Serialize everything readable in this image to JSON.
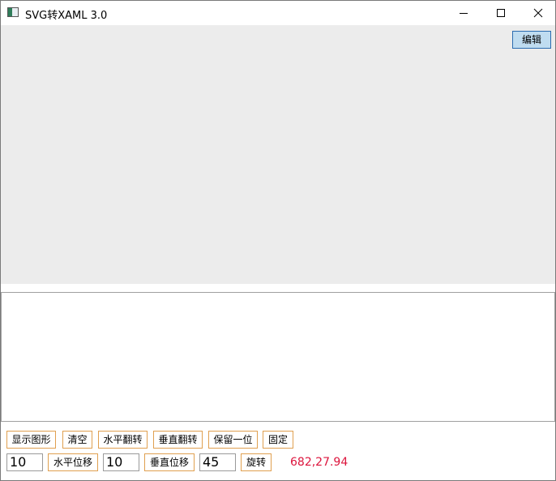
{
  "window": {
    "title": "SVG转XAML 3.0"
  },
  "canvas": {
    "edit_label": "编辑"
  },
  "toolbar": {
    "row1": {
      "show_shape": "显示图形",
      "clear": "清空",
      "flip_horizontal": "水平翻转",
      "flip_vertical": "垂直翻转",
      "keep_one_decimal": "保留一位",
      "fix": "固定"
    },
    "row2": {
      "h_offset_value": "10",
      "h_offset_label": "水平位移",
      "v_offset_value": "10",
      "v_offset_label": "垂直位移",
      "rotate_value": "45",
      "rotate_label": "旋转"
    },
    "coordinates": "682,27.94"
  },
  "colors": {
    "canvas_bg": "#ececec",
    "edit_button_bg": "#bfdcf0",
    "toolbar_button_border": "#e0a050",
    "coordinate_text": "#dc143c"
  },
  "icons": {
    "app": "app-window-icon",
    "minimize": "minimize-icon",
    "maximize": "maximize-icon",
    "close": "close-icon"
  }
}
